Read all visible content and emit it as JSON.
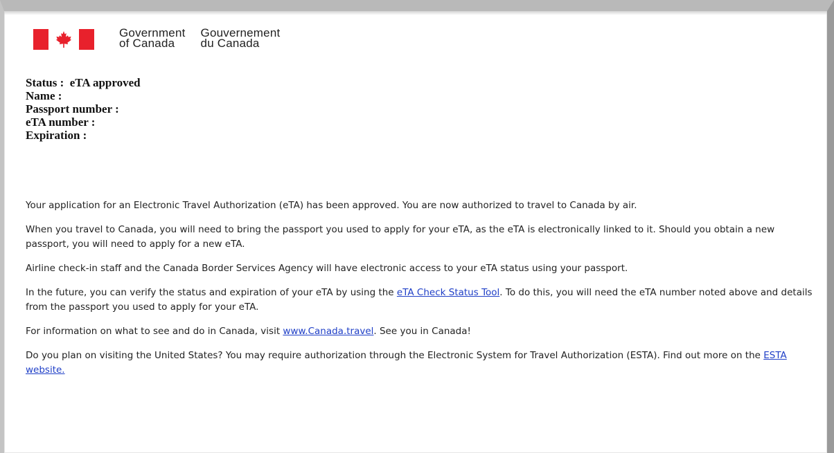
{
  "header": {
    "gov_en_line1": "Government",
    "gov_en_line2": "of Canada",
    "gov_fr_line1": "Gouvernement",
    "gov_fr_line2": "du Canada",
    "flag_color": "#e8212c"
  },
  "status": {
    "status_label": "Status :",
    "status_value": "eTA approved",
    "name_label": "Name :",
    "passport_label": "Passport number :",
    "eta_number_label": "eTA number :",
    "expiration_label": "Expiration :"
  },
  "body": {
    "p1": "Your application for an Electronic Travel Authorization (eTA) has been approved. You are now authorized to travel to Canada by air.",
    "p2": "When you travel to Canada, you will need to bring the passport you used to apply for your eTA, as the eTA is electronically linked to it. Should you obtain a new passport, you will need to apply for a new eTA.",
    "p3": "Airline check-in staff and the Canada Border Services Agency will have electronic access to your eTA status using your passport.",
    "p4_before": "In the future, you can verify the status and expiration of your eTA by using the ",
    "p4_link": "eTA Check Status Tool",
    "p4_after": ". To do this, you will need the eTA number noted above and details from the passport you used to apply for your eTA.",
    "p5_before": "For information on what to see and do in Canada, visit ",
    "p5_link": "www.Canada.travel",
    "p5_after": ". See you in Canada!",
    "p6_before": "Do you plan on visiting the United States? You may require authorization through the Electronic System for Travel Authorization (ESTA). Find out more on the ",
    "p6_link": "ESTA website."
  },
  "colors": {
    "link": "#1f3fc7",
    "text": "#222222"
  }
}
